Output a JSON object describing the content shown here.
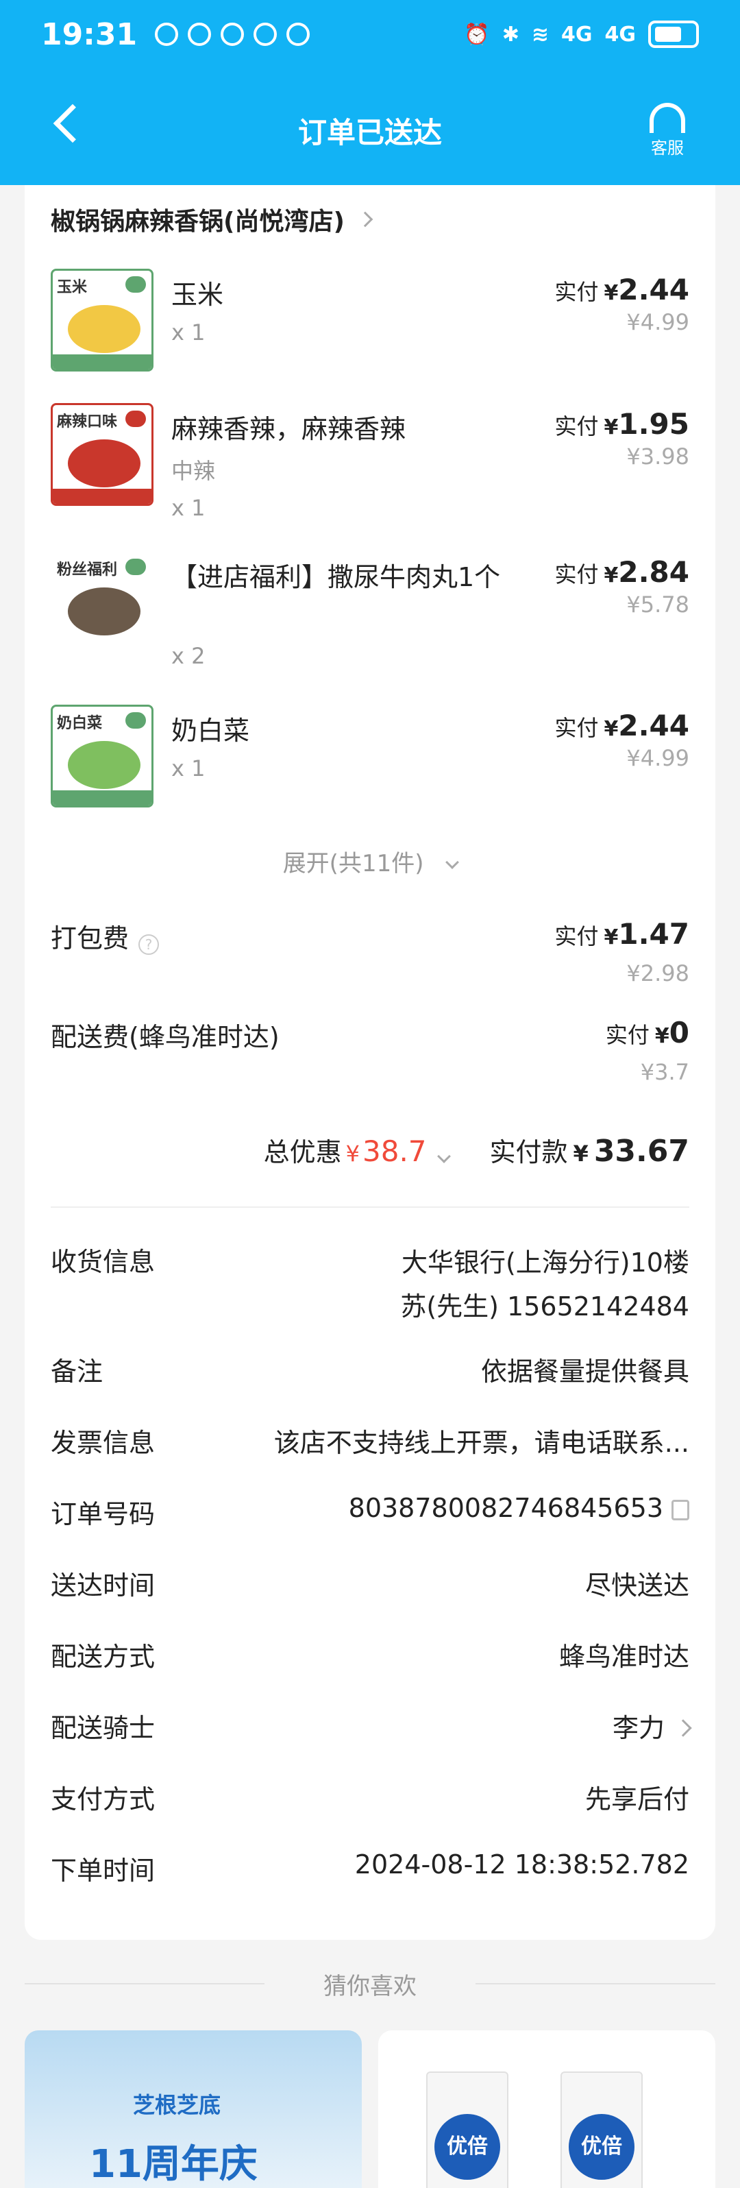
{
  "status_bar": {
    "time": "19:31",
    "network1": "4G",
    "network2": "4G"
  },
  "header": {
    "title": "订单已送达",
    "service_label": "客服"
  },
  "shop": {
    "name": "椒锅锅麻辣香锅(尚悦湾店)"
  },
  "items": [
    {
      "thumb_tag": "玉米",
      "name": "玉米",
      "spec": "",
      "qty": "x 1",
      "paid_label": "实付",
      "currency": "¥",
      "paid": "2.44",
      "original": "¥4.99",
      "thumb_color": "#f2c844"
    },
    {
      "thumb_tag": "麻辣口味",
      "name": "麻辣香辣，麻辣香辣",
      "spec": "中辣",
      "qty": "x 1",
      "paid_label": "实付",
      "currency": "¥",
      "paid": "1.95",
      "original": "¥3.98",
      "thumb_color": "#c9372c"
    },
    {
      "thumb_tag": "粉丝福利",
      "name": "【进店福利】撒尿牛肉丸1个",
      "spec": "",
      "qty": "x 2",
      "paid_label": "实付",
      "currency": "¥",
      "paid": "2.84",
      "original": "¥5.78",
      "thumb_color": "#6b5a4a"
    },
    {
      "thumb_tag": "奶白菜",
      "name": "奶白菜",
      "spec": "",
      "qty": "x 1",
      "paid_label": "实付",
      "currency": "¥",
      "paid": "2.44",
      "original": "¥4.99",
      "thumb_color": "#7fbf5f"
    }
  ],
  "expand_label": "展开(共11件)",
  "fees": [
    {
      "name": "打包费",
      "paid_label": "实付",
      "currency": "¥",
      "paid": "1.47",
      "original": "¥2.98"
    },
    {
      "name": "配送费(蜂鸟准时达)",
      "paid_label": "实付",
      "currency": "¥",
      "paid": "0",
      "original": "¥3.7"
    }
  ],
  "summary": {
    "discount_label": "总优惠",
    "discount_currency": "¥",
    "discount_value": "38.7",
    "paid_label": "实付款",
    "paid_currency": "¥",
    "paid_value": "33.67"
  },
  "info": {
    "address": {
      "label": "收货信息",
      "line1": "大华银行(上海分行)10楼",
      "line2": "苏(先生) 15652142484"
    },
    "remark": {
      "label": "备注",
      "value": "依据餐量提供餐具"
    },
    "invoice": {
      "label": "发票信息",
      "value": "该店不支持线上开票，请电话联系..."
    },
    "order_no": {
      "label": "订单号码",
      "value": "8038780082746845653"
    },
    "delivery_time": {
      "label": "送达时间",
      "value": "尽快送达"
    },
    "delivery_method": {
      "label": "配送方式",
      "value": "蜂鸟准时达"
    },
    "rider": {
      "label": "配送骑士",
      "value": "李力"
    },
    "payment": {
      "label": "支付方式",
      "value": "先享后付"
    },
    "order_time": {
      "label": "下单时间",
      "value": "2024-08-12 18:38:52.782"
    }
  },
  "recommend": {
    "title": "猜你喜欢",
    "card1_brand": "芝根芝底",
    "card1_text": "11周年庆",
    "card2_logo": "优倍"
  },
  "colors": {
    "brand_blue": "#12b3f5",
    "discount_red": "#f04a3a"
  }
}
